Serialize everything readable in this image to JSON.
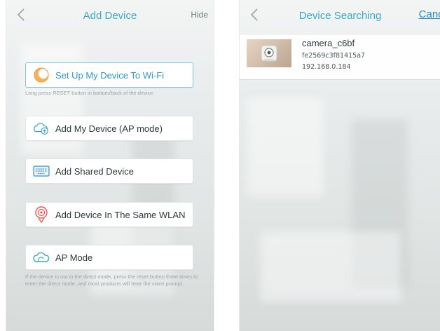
{
  "left_screen": {
    "header": {
      "title": "Add Device",
      "right_action": "Hide"
    },
    "setup_wifi": {
      "label": "Set Up My Device To Wi-Fi",
      "hint": "Long press RESET button in bottom/back of the device"
    },
    "ap_add": {
      "label": "Add My Device (AP mode)"
    },
    "shared": {
      "label": "Add Shared Device"
    },
    "same_wlan": {
      "label": "Add Device In The Same WLAN"
    },
    "ap_mode": {
      "label": "AP Mode",
      "hint": "If the device is not in the direct mode, press the reset button three times to enter the direct mode, and most products will hear the voice prompt."
    }
  },
  "right_screen": {
    "header": {
      "title": "Device Searching",
      "right_action": "Cance"
    },
    "results": [
      {
        "name": "camera_c6bf",
        "id": "fe2569c3f81415a7",
        "ip": "192.168.0.184"
      }
    ]
  },
  "colors": {
    "accent": "#3aa7cc",
    "link": "#2a88c6",
    "text": "#2f3a3c",
    "hint": "#9aa4a6"
  },
  "icons": [
    "chevron-left-icon",
    "wifi-setup-icon",
    "cloud-add-icon",
    "keyboard-icon",
    "location-pin-icon",
    "cloud-icon",
    "camera-thumbnail"
  ]
}
